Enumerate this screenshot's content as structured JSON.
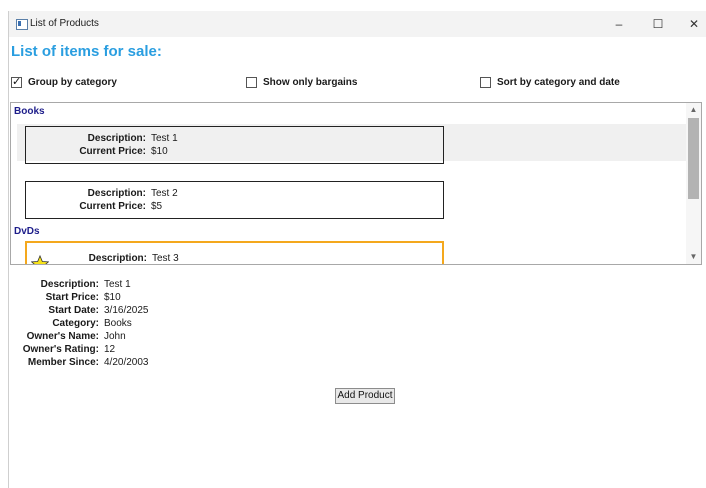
{
  "window": {
    "title": "List of Products",
    "controls": {
      "minimize": "–",
      "maximize": "☐",
      "close": "✕"
    }
  },
  "heading": "List of items for sale:",
  "options": [
    {
      "label": "Group by category",
      "checked": true
    },
    {
      "label": "Show only bargains",
      "checked": false
    },
    {
      "label": "Sort by category and date",
      "checked": false
    }
  ],
  "list": {
    "groups": [
      {
        "name": "Books",
        "items": [
          {
            "description_label": "Description:",
            "description": "Test 1",
            "price_label": "Current Price:",
            "price": "$10",
            "highlighted": true
          },
          {
            "description_label": "Description:",
            "description": "Test 2",
            "price_label": "Current Price:",
            "price": "$5",
            "highlighted": false
          }
        ]
      },
      {
        "name": "DvDs",
        "items": [
          {
            "description_label": "Description:",
            "description": "Test 3",
            "featured": true
          }
        ]
      }
    ],
    "scroll_up": "▲",
    "scroll_down": "▼",
    "star_color": "#f7e21a",
    "selected_border_color": "#f4a81d"
  },
  "details": [
    {
      "label": "Description:",
      "value": "Test 1"
    },
    {
      "label": "Start Price:",
      "value": "$10"
    },
    {
      "label": "Start Date:",
      "value": "3/16/2025"
    },
    {
      "label": "Category:",
      "value": "Books"
    },
    {
      "label": "Owner's Name:",
      "value": "John"
    },
    {
      "label": "Owner's Rating:",
      "value": "12"
    },
    {
      "label": "Member Since:",
      "value": "4/20/2003"
    }
  ],
  "add_button": "Add Product",
  "colors": {
    "heading": "#2a9ee0",
    "group_header": "#1d1d8a"
  }
}
